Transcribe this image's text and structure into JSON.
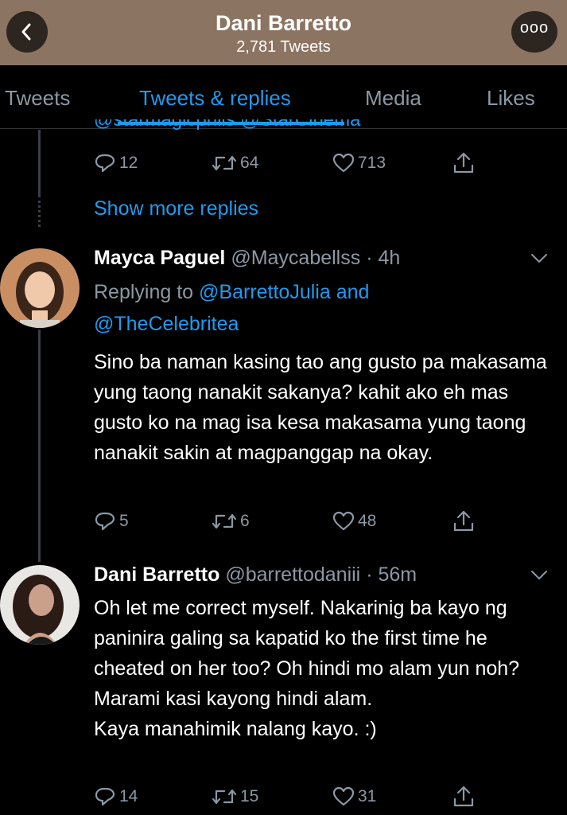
{
  "header": {
    "title": "Dani Barretto",
    "subtitle": "2,781 Tweets",
    "more_label": "ooo"
  },
  "tabs": [
    {
      "label": "Tweets",
      "active": false
    },
    {
      "label": "Tweets & replies",
      "active": true
    },
    {
      "label": "Media",
      "active": false
    },
    {
      "label": "Likes",
      "active": false
    }
  ],
  "prev_tweet": {
    "cut_text": "@starmagicphils @StarCinema",
    "replies": "12",
    "retweets": "64",
    "likes": "713"
  },
  "show_more": "Show more replies",
  "tweets": [
    {
      "name": "Mayca Paguel",
      "handle": "@Maycabellss",
      "time": "· 4h",
      "replying_prefix": "Replying to ",
      "replying_to_1": "@BarrettoJulia",
      "replying_and": " and",
      "replying_to_2": "@TheCelebritea",
      "body": "Sino ba naman kasing tao ang gusto pa makasama yung taong nanakit sakanya? kahit ako eh mas gusto ko na mag isa kesa makasama yung taong nanakit sakin at magpanggap na okay.",
      "replies": "5",
      "retweets": "6",
      "likes": "48"
    },
    {
      "name": "Dani Barretto",
      "handle": "@barrettodaniii",
      "time": "· 56m",
      "body": "Oh let me correct myself. Nakarinig ba kayo ng paninira galing sa kapatid ko the first time he cheated on her too? Oh hindi mo alam yun noh? Marami kasi kayong hindi alam.\nKaya manahimik nalang kayo. :)",
      "replies": "14",
      "retweets": "15",
      "likes": "31"
    }
  ],
  "colors": {
    "header_bg": "#8c7462",
    "accent": "#1d9bf0",
    "muted": "#8b98a5",
    "background": "#000000"
  }
}
